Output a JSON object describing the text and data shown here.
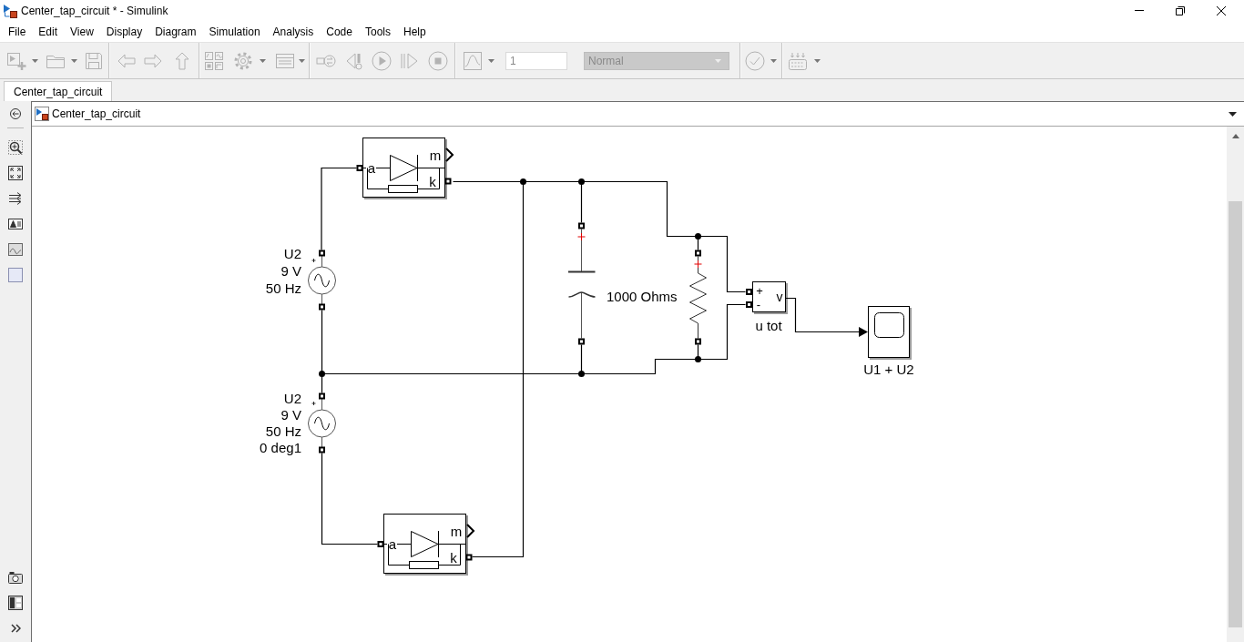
{
  "window": {
    "title": "Center_tap_circuit * - Simulink"
  },
  "menu": [
    "File",
    "Edit",
    "View",
    "Display",
    "Diagram",
    "Simulation",
    "Analysis",
    "Code",
    "Tools",
    "Help"
  ],
  "toolbar": {
    "disabled": true,
    "stop_time": "1",
    "mode": "Normal"
  },
  "tabs": [
    {
      "label": "Center_tap_circuit",
      "selected": true
    }
  ],
  "address_bar": {
    "path": "Center_tap_circuit"
  },
  "diagram": {
    "blocks": [
      {
        "kind": "diode",
        "output_port": "m",
        "anode_port": "a",
        "cathode_port": "k"
      },
      {
        "kind": "ac_source",
        "label_lines": [
          "U2",
          "9 V",
          "50 Hz"
        ]
      },
      {
        "kind": "capacitor"
      },
      {
        "kind": "resistor",
        "label": "1000 Ohms"
      },
      {
        "kind": "voltage_sensor",
        "plus_port": "+",
        "minus_port": "-",
        "output_port": "v",
        "label": "u tot"
      },
      {
        "kind": "scope",
        "label": "U1 + U2"
      },
      {
        "kind": "ac_source",
        "label_lines": [
          "U2",
          "9 V",
          "50 Hz",
          "0 deg1"
        ]
      },
      {
        "kind": "diode",
        "output_port": "m",
        "anode_port": "a",
        "cathode_port": "k"
      }
    ]
  }
}
